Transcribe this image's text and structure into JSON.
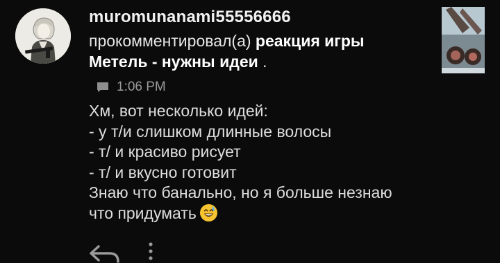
{
  "notification": {
    "username": "muromunanami55556666",
    "verb": "прокомментировал(а)",
    "target_line1": "реакция игры",
    "target_line2": "Метель - нужны идеи",
    "target_suffix": " .",
    "time": "1:06 PM",
    "comment_lines": [
      "Хм, вот несколько идей:",
      "- у т/и слишком длинные волосы",
      "- т/ и красиво рисует",
      "- т/ и вкусно готовит",
      "Знаю что банально, но я больше незнаю",
      "что придумать"
    ],
    "emoji": "grinning-face-with-sweat",
    "icons": {
      "comment": "comment-icon",
      "reply": "reply-icon",
      "more": "more-vertical-icon"
    }
  },
  "colors": {
    "background": "#0b0b0b",
    "username": "#f2f2f2",
    "text": "#dedede",
    "timestamp": "#9a9a9a"
  }
}
